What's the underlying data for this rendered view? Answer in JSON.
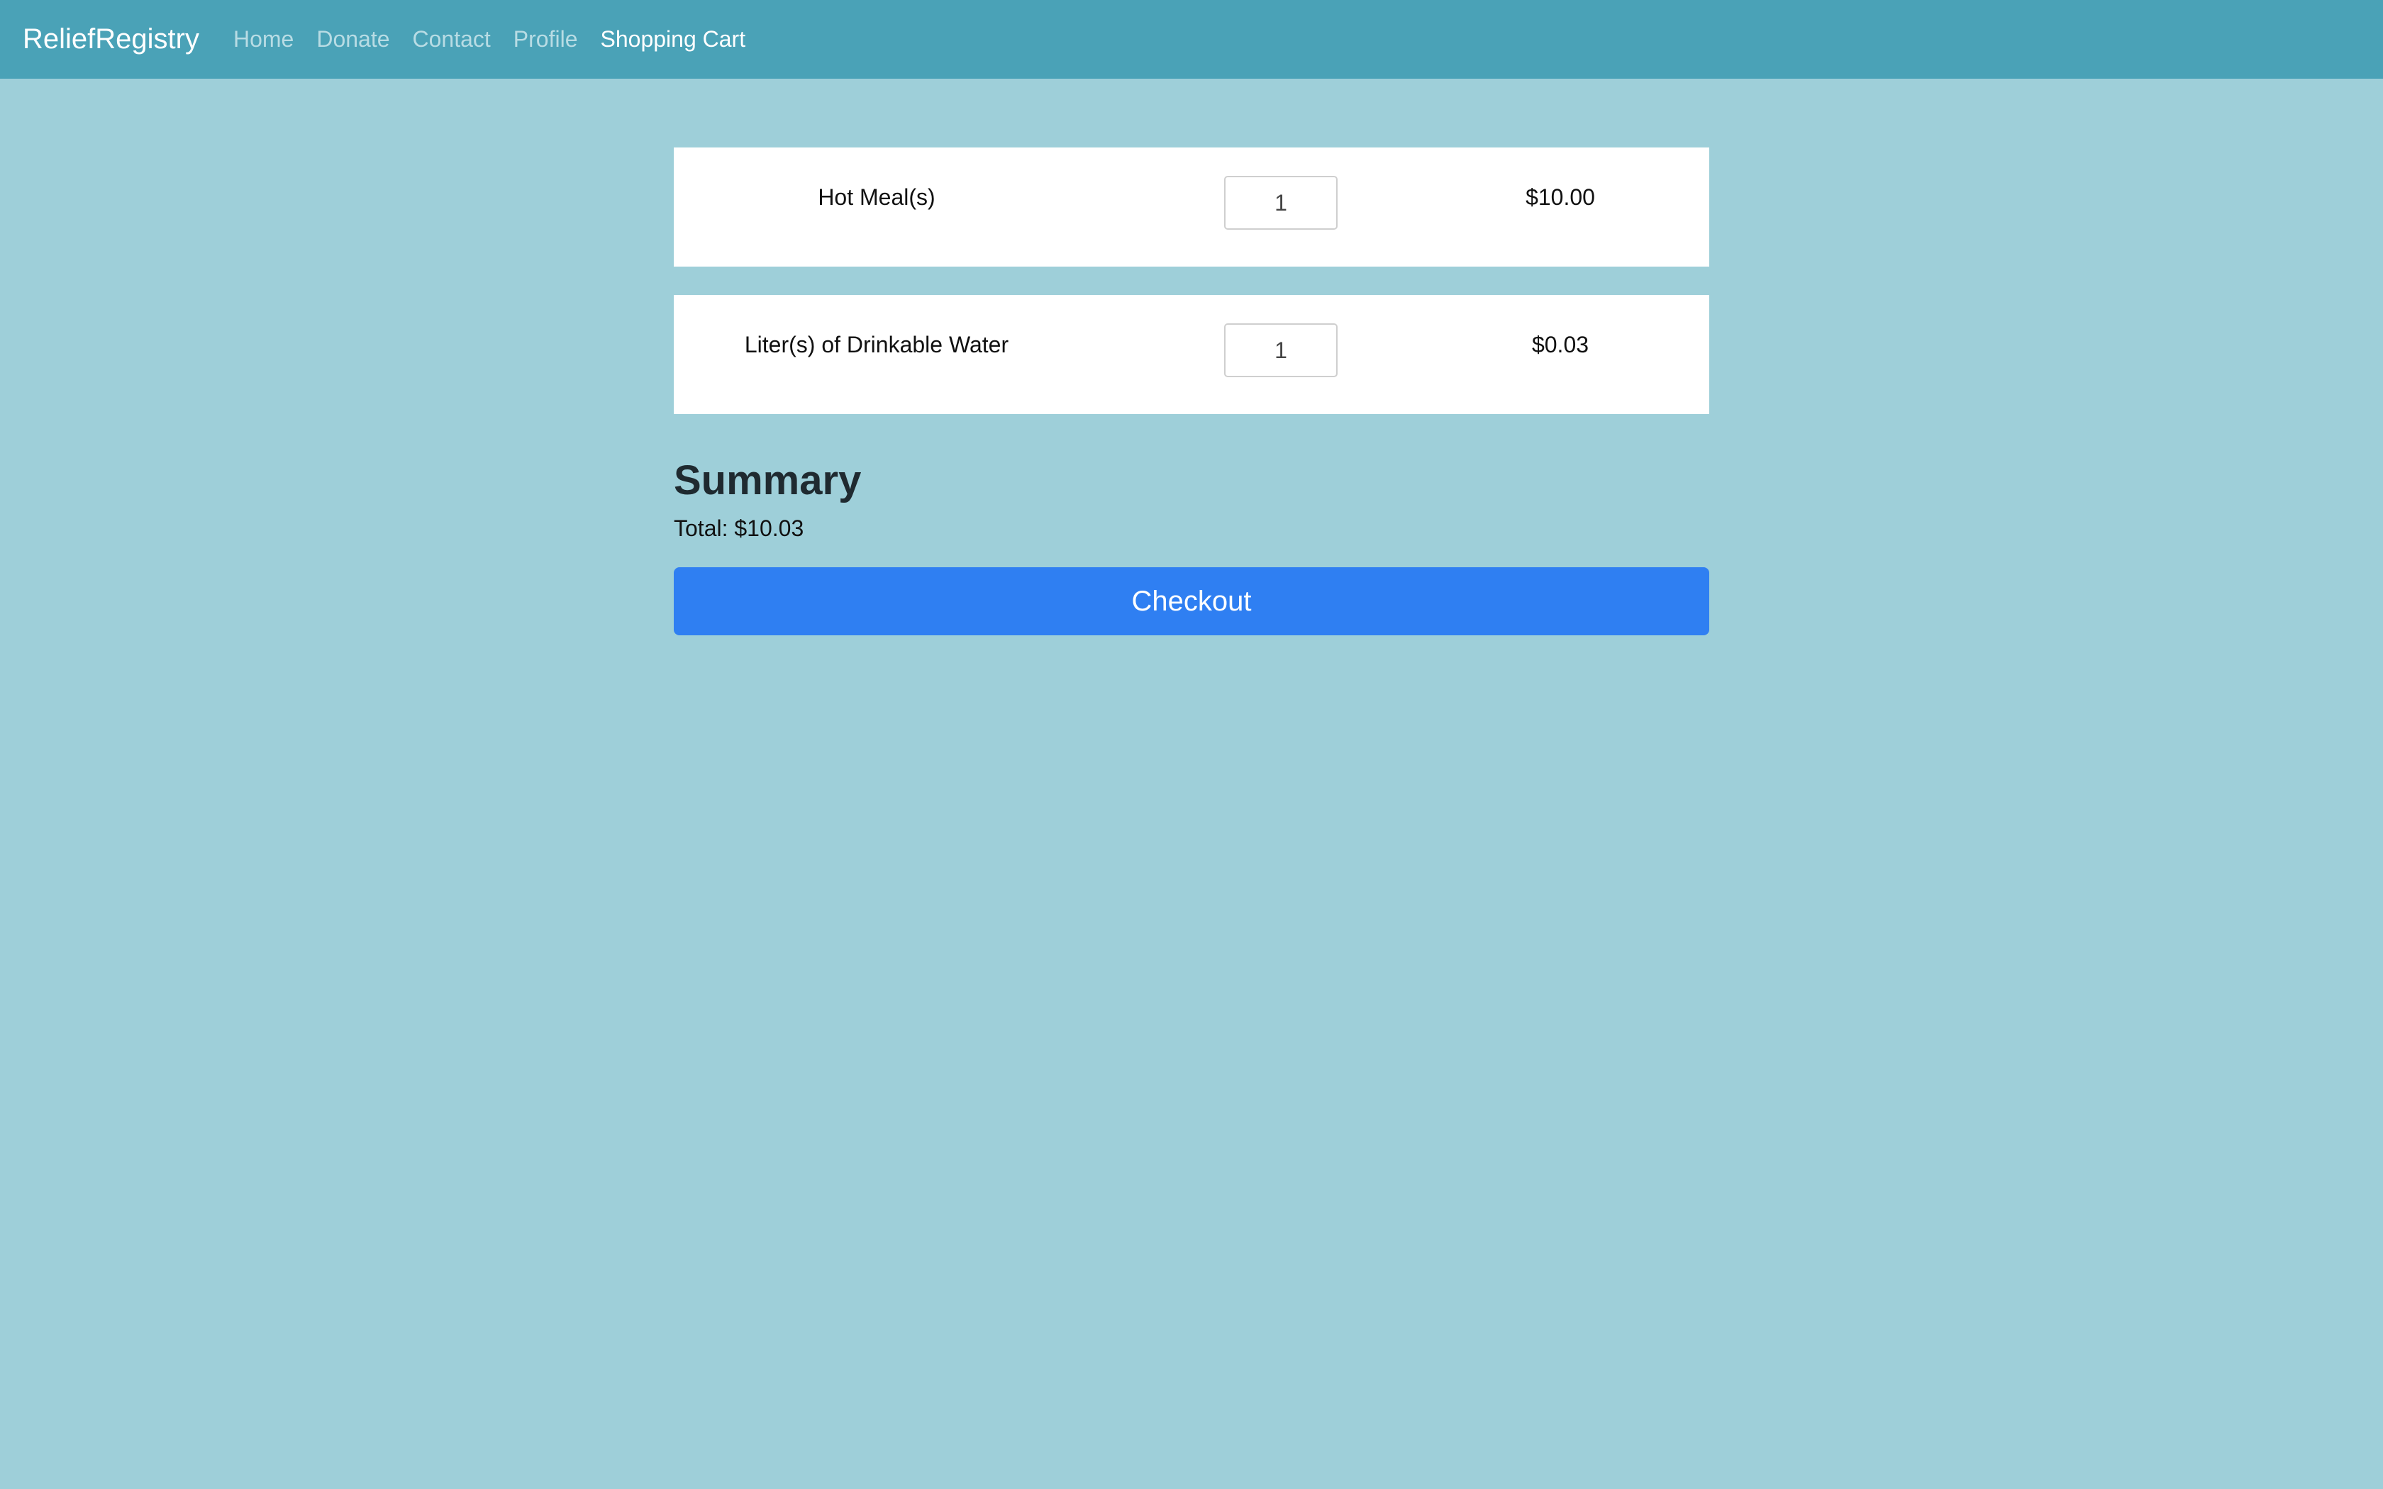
{
  "navbar": {
    "brand": "ReliefRegistry",
    "links": [
      {
        "label": "Home",
        "active": false
      },
      {
        "label": "Donate",
        "active": false
      },
      {
        "label": "Contact",
        "active": false
      },
      {
        "label": "Profile",
        "active": false
      },
      {
        "label": "Shopping Cart",
        "active": true
      }
    ]
  },
  "cart": {
    "items": [
      {
        "name": "Hot Meal(s)",
        "quantity": "1",
        "price": "$10.00"
      },
      {
        "name": "Liter(s) of Drinkable Water",
        "quantity": "1",
        "price": "$0.03"
      }
    ]
  },
  "summary": {
    "title": "Summary",
    "total_label": "Total: $10.03",
    "checkout_label": "Checkout"
  },
  "colors": {
    "page_background": "#9ecfd9",
    "navbar_background": "#4aa2b7",
    "checkout_button": "#2f7ff2"
  }
}
